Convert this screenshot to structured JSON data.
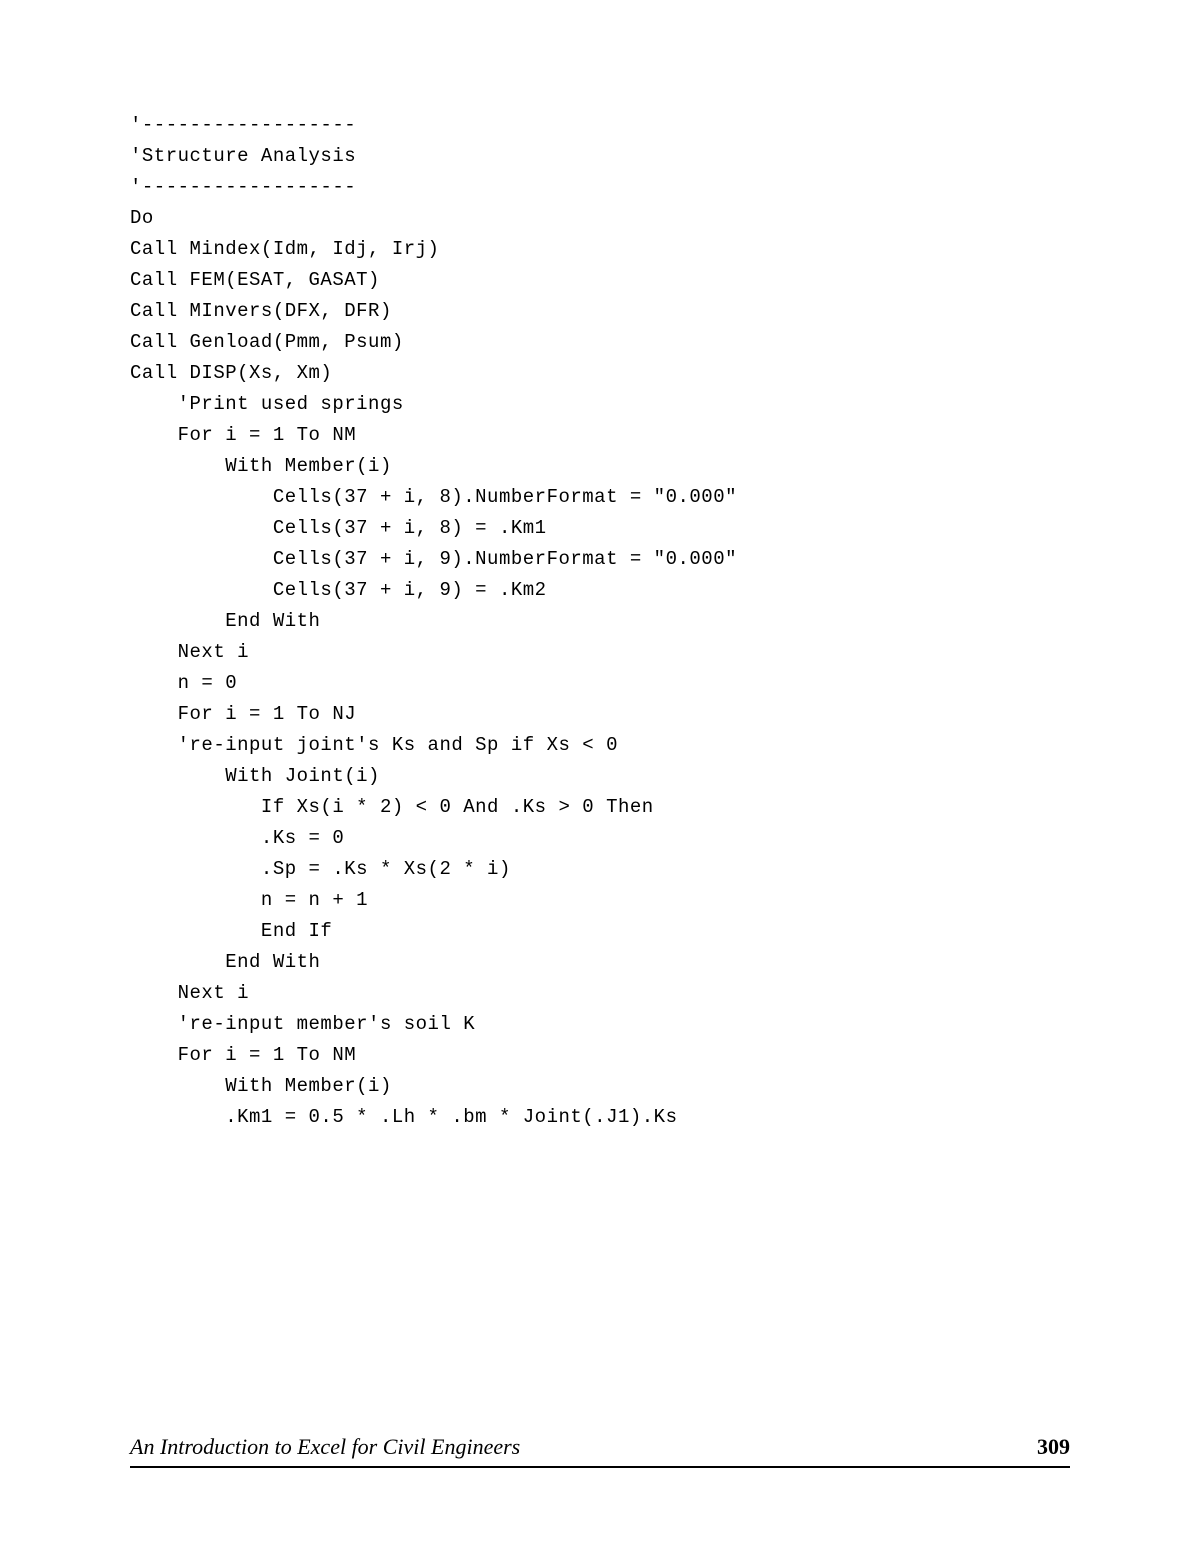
{
  "code": {
    "lines": [
      "'------------------",
      "'Structure Analysis",
      "'------------------",
      "Do",
      "",
      "Call Mindex(Idm, Idj, Irj)",
      "Call FEM(ESAT, GASAT)",
      "Call MInvers(DFX, DFR)",
      "Call Genload(Pmm, Psum)",
      "Call DISP(Xs, Xm)",
      "",
      "    'Print used springs",
      "    For i = 1 To NM",
      "        With Member(i)",
      "            Cells(37 + i, 8).NumberFormat = \"0.000\"",
      "            Cells(37 + i, 8) = .Km1",
      "            Cells(37 + i, 9).NumberFormat = \"0.000\"",
      "            Cells(37 + i, 9) = .Km2",
      "        End With",
      "    Next i",
      "",
      "    n = 0",
      "    For i = 1 To NJ",
      "    're-input joint's Ks and Sp if Xs < 0",
      "        With Joint(i)",
      "           If Xs(i * 2) < 0 And .Ks > 0 Then",
      "           .Ks = 0",
      "           .Sp = .Ks * Xs(2 * i)",
      "           n = n + 1",
      "           End If",
      "        End With",
      "    Next i",
      "",
      "    're-input member's soil K",
      "    For i = 1 To NM",
      "        With Member(i)",
      "        .Km1 = 0.5 * .Lh * .bm * Joint(.J1).Ks"
    ]
  },
  "footer": {
    "title": "An Introduction to Excel for Civil Engineers",
    "page": "309"
  }
}
